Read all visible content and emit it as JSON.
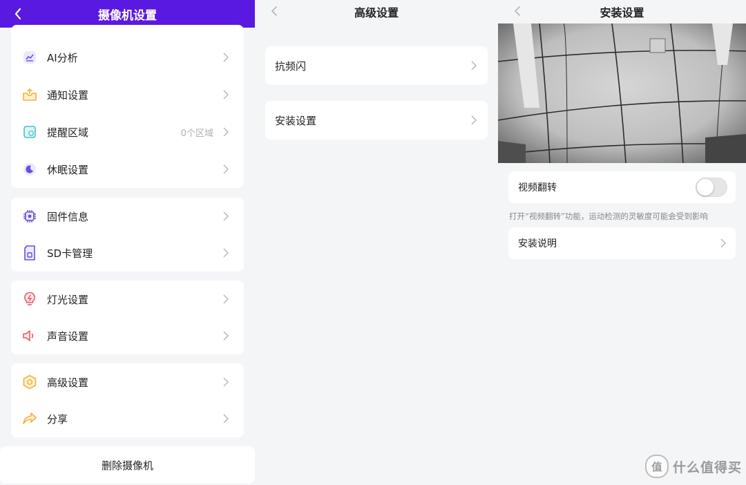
{
  "panel_camera_settings": {
    "title": "摄像机设置",
    "groups": [
      [
        {
          "icon": "chart-icon",
          "label": "AI分析",
          "value": ""
        },
        {
          "icon": "inbox-icon",
          "label": "通知设置",
          "value": ""
        },
        {
          "icon": "area-icon",
          "label": "提醒区域",
          "value": "0个区域"
        },
        {
          "icon": "moon-icon",
          "label": "休眠设置",
          "value": ""
        }
      ],
      [
        {
          "icon": "chip-icon",
          "label": "固件信息",
          "value": ""
        },
        {
          "icon": "sd-card-icon",
          "label": "SD卡管理",
          "value": ""
        }
      ],
      [
        {
          "icon": "bulb-icon",
          "label": "灯光设置",
          "value": ""
        },
        {
          "icon": "speaker-icon",
          "label": "声音设置",
          "value": ""
        }
      ],
      [
        {
          "icon": "hexagon-icon",
          "label": "高级设置",
          "value": ""
        },
        {
          "icon": "share-icon",
          "label": "分享",
          "value": ""
        }
      ]
    ],
    "delete_label": "删除摄像机"
  },
  "panel_advanced_settings": {
    "title": "高级设置",
    "items": [
      "抗频闪",
      "安装设置"
    ]
  },
  "panel_install_settings": {
    "title": "安装设置",
    "video_flip_label": "视频翻转",
    "video_flip_on": false,
    "hint": "打开“视频翻转”功能，运动检测的灵敏度可能会受到影响",
    "install_guide_label": "安装说明"
  },
  "watermark": {
    "logo_char": "值",
    "text": "什么值得买"
  },
  "colors": {
    "header_purple": "#5a19e0",
    "icon_purple": "#6a4de0",
    "icon_orange": "#f0b33c",
    "icon_teal": "#3bc4c9",
    "icon_red": "#e8596a"
  }
}
